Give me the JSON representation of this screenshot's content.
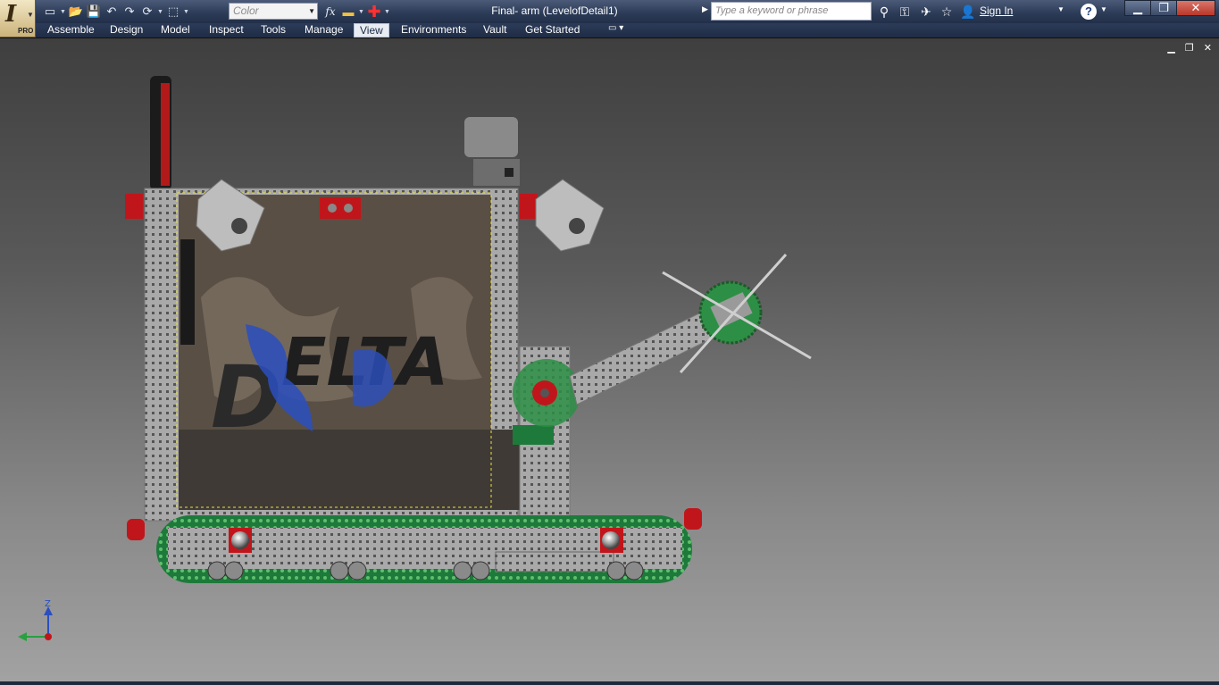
{
  "app": {
    "edition": "PRO",
    "document_title": "Final- arm (LevelofDetail1)"
  },
  "quick_access": {
    "color_placeholder": "Color",
    "formula_icon_text": "fx"
  },
  "search": {
    "placeholder": "Type a keyword or phrase"
  },
  "account": {
    "sign_in_label": "Sign In"
  },
  "ribbon": {
    "tabs": [
      {
        "label": "Assemble"
      },
      {
        "label": "Design"
      },
      {
        "label": "Model"
      },
      {
        "label": "Inspect"
      },
      {
        "label": "Tools"
      },
      {
        "label": "Manage"
      },
      {
        "label": "View",
        "active": true
      },
      {
        "label": "Environments"
      },
      {
        "label": "Vault"
      },
      {
        "label": "Get Started"
      }
    ]
  },
  "viewport": {
    "model_text": "ELTA",
    "model_initial": "D",
    "triad_axis_z": "Z"
  },
  "colors": {
    "title_bar": "#2b3a55",
    "viewport_top": "#3f3f3f",
    "viewport_bottom": "#a2a2a2",
    "frame_metal": "#9a9a9a",
    "accent_red": "#c0161b",
    "track_green": "#1d7a3a"
  }
}
